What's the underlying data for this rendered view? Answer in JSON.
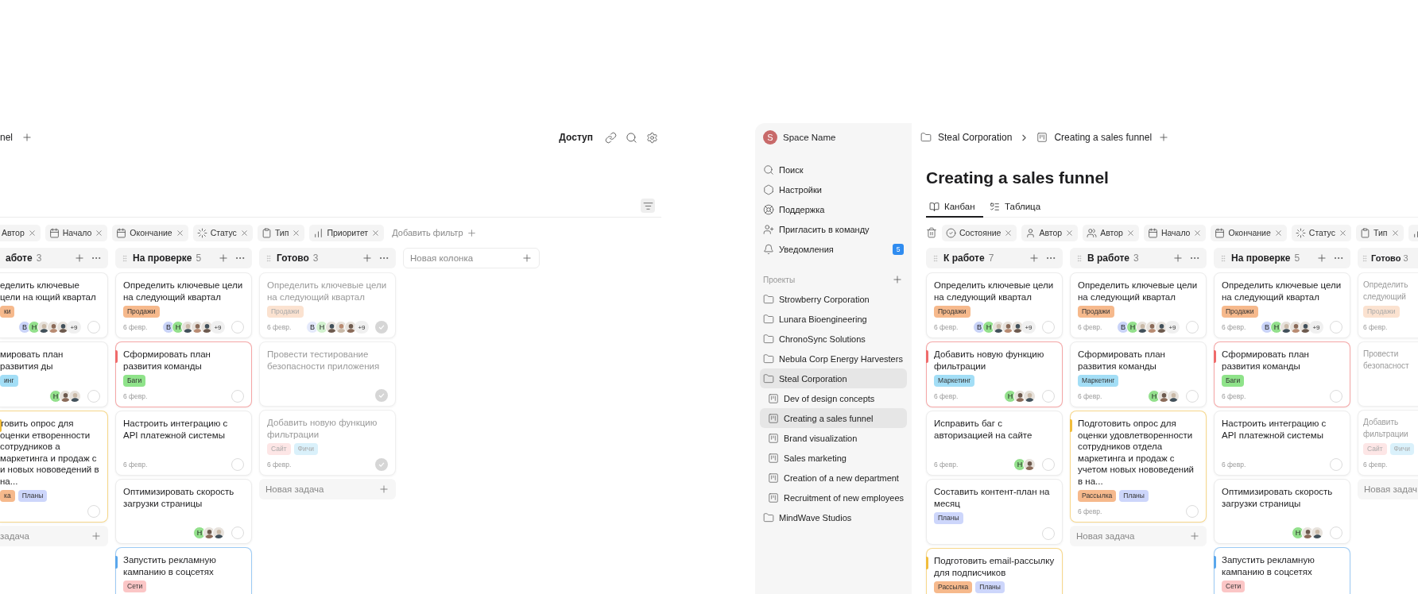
{
  "left_view": {
    "breadcrumb_tail": "nel",
    "access": "Доступ",
    "filters": [
      {
        "kind": "plain",
        "label": "Автор"
      },
      {
        "kind": "calendar",
        "label": "Начало"
      },
      {
        "kind": "calendar",
        "label": "Окончание"
      },
      {
        "kind": "status",
        "label": "Статус"
      },
      {
        "kind": "type",
        "label": "Тип"
      },
      {
        "kind": "priority",
        "label": "Приоритет"
      }
    ],
    "add_filter": "Добавить фильтр",
    "columns": [
      {
        "kind": "cut-left",
        "title": "аботе",
        "count": "3",
        "new_task": "задача",
        "cards": [
          {
            "title": "еделить ключевые цели на ющий квартал",
            "tags": [
              {
                "label": "ки",
                "color": "#f6b98c"
              }
            ],
            "avatars": [
              {
                "kind": "letter",
                "letter": "В",
                "color": "#c9d3f8"
              },
              {
                "kind": "letter",
                "letter": "Н",
                "color": "#93e08c"
              },
              {
                "kind": "photo"
              },
              {
                "kind": "photo"
              },
              {
                "kind": "photo"
              }
            ],
            "more": "+9",
            "done": false
          },
          {
            "title": "мировать план развития ды",
            "tags": [
              {
                "label": "инг",
                "color": "#a3def6"
              }
            ],
            "avatars": [
              {
                "kind": "letter",
                "letter": "Н",
                "color": "#93e08c"
              },
              {
                "kind": "photo"
              },
              {
                "kind": "photo"
              }
            ],
            "done": false
          },
          {
            "title": "товить опрос для оценки етворенности сотрудников а маркетинга и продаж с и новых нововедений в на...",
            "tags": [
              {
                "label": "ка",
                "color": "#f6b98c"
              },
              {
                "label": "Планы",
                "color": "#cdd6fb"
              }
            ],
            "color": "#f1bd3c",
            "done": false
          }
        ]
      },
      {
        "kind": "full",
        "title": "На проверке",
        "count": "5",
        "cards": [
          {
            "title": "Определить ключевые цели на следующий квартал",
            "tags": [
              {
                "label": "Продажи",
                "color": "#f6b98c"
              }
            ],
            "date": "6 февр.",
            "avatars": [
              {
                "kind": "letter",
                "letter": "В",
                "color": "#c9d3f8"
              },
              {
                "kind": "letter",
                "letter": "Н",
                "color": "#93e08c"
              },
              {
                "kind": "photo"
              },
              {
                "kind": "photo"
              },
              {
                "kind": "photo"
              }
            ],
            "more": "+9",
            "done": false
          },
          {
            "title": "Сформировать план развития команды",
            "tags": [
              {
                "label": "Баги",
                "color": "#8fe38a"
              }
            ],
            "date": "6 февр.",
            "color": "#ef6b6b",
            "done": false
          },
          {
            "title": "Настроить интеграцию с API платежной системы",
            "date": "6 февр.",
            "done": false
          },
          {
            "title": "Оптимизировать скорость загрузки страницы",
            "avatars": [
              {
                "kind": "letter",
                "letter": "Н",
                "color": "#93e08c"
              },
              {
                "kind": "photo"
              },
              {
                "kind": "photo"
              }
            ],
            "done": false
          },
          {
            "title": "Запустить рекламную кампанию в соцсетях",
            "tags": [
              {
                "label": "Сети",
                "color": "#fbc6c6"
              }
            ],
            "color": "#5aa7ec",
            "done": false
          }
        ]
      },
      {
        "kind": "full",
        "title": "Готово",
        "count": "3",
        "new_task": "Новая задача",
        "cards": [
          {
            "title": "Определить ключевые цели на следующий квартал",
            "tags": [
              {
                "label": "Продажи",
                "color": "#fbe2d0"
              }
            ],
            "date": "6 февр.",
            "avatars": [
              {
                "kind": "letter",
                "letter": "В",
                "color": "#e4e9fb"
              },
              {
                "kind": "letter",
                "letter": "Н",
                "color": "#d2f2cf"
              },
              {
                "kind": "photo"
              },
              {
                "kind": "photo"
              },
              {
                "kind": "photo"
              }
            ],
            "more": "+9",
            "done": true
          },
          {
            "title": "Провести тестирование безопасности приложения",
            "done": true
          },
          {
            "title": "Добавить новую функцию фильтрации",
            "tags": [
              {
                "label": "Сайт",
                "color": "#fde6e6"
              },
              {
                "label": "Фичи",
                "color": "#daf1fb"
              }
            ],
            "date": "6 февр.",
            "done": true
          }
        ]
      }
    ],
    "new_column": "Новая колонка"
  },
  "sidebar": {
    "space": {
      "initial": "S",
      "name": "Space Name"
    },
    "nav": [
      {
        "kind": "search",
        "label": "Поиск"
      },
      {
        "kind": "settings",
        "label": "Настройки"
      },
      {
        "kind": "support",
        "label": "Поддержка"
      },
      {
        "kind": "invite",
        "label": "Пригласить в команду"
      },
      {
        "kind": "bell",
        "label": "Уведомления",
        "badge": "5"
      }
    ],
    "projects_label": "Проекты",
    "projects": [
      {
        "name": "Strowberry Corporation",
        "selected": false
      },
      {
        "name": "Lunara Bioengineering",
        "selected": false
      },
      {
        "name": "ChronoSync Solutions",
        "selected": false
      },
      {
        "name": "Nebula Corp Energy Harvesters",
        "selected": false
      },
      {
        "name": "Steal Corporation",
        "selected": true,
        "children": [
          {
            "name": "Dev of design concepts",
            "selected": false
          },
          {
            "name": "Creating a sales funnel",
            "selected": true
          },
          {
            "name": "Brand visualization",
            "selected": false
          },
          {
            "name": "Sales marketing",
            "selected": false
          },
          {
            "name": "Creation of a new department",
            "selected": false
          },
          {
            "name": "Recruitment of new employees",
            "selected": false
          }
        ]
      },
      {
        "name": "MindWave Studios",
        "selected": false
      }
    ]
  },
  "main": {
    "breadcrumb": [
      "Steal Corporation",
      "Creating a sales funnel"
    ],
    "title": "Creating a sales funnel",
    "tabs": [
      {
        "kind": "kanban",
        "label": "Канбан",
        "selected": true
      },
      {
        "kind": "table",
        "label": "Таблица",
        "selected": false
      }
    ],
    "filters": [
      {
        "kind": "state",
        "label": "Состояние"
      },
      {
        "kind": "author",
        "label": "Автор"
      },
      {
        "kind": "authors",
        "label": "Автор"
      },
      {
        "kind": "calendar",
        "label": "Начало"
      },
      {
        "kind": "calendar",
        "label": "Окончание"
      },
      {
        "kind": "status",
        "label": "Статус"
      },
      {
        "kind": "type",
        "label": "Тип"
      },
      {
        "kind": "priority"
      }
    ],
    "columns": [
      {
        "kind": "full",
        "title": "К работе",
        "count": "7",
        "cards": [
          {
            "title": "Определить ключевые цели на следующий квартал",
            "tags": [
              {
                "label": "Продажи",
                "color": "#f6b98c"
              }
            ],
            "date": "6 февр.",
            "avatars": [
              {
                "kind": "letter",
                "letter": "В",
                "color": "#c9d3f8"
              },
              {
                "kind": "letter",
                "letter": "Н",
                "color": "#93e08c"
              },
              {
                "kind": "photo"
              },
              {
                "kind": "photo"
              },
              {
                "kind": "photo"
              }
            ],
            "more": "+9",
            "done": false
          },
          {
            "title": "Добавить новую функцию фильтрации",
            "tags": [
              {
                "label": "Маркетинг",
                "color": "#a3def6"
              }
            ],
            "date": "6 февр.",
            "color": "#ef6b6b",
            "avatars": [
              {
                "kind": "letter",
                "letter": "Н",
                "color": "#93e08c"
              },
              {
                "kind": "photo"
              },
              {
                "kind": "photo"
              }
            ],
            "done": false
          },
          {
            "title": "Исправить баг с авторизацией на сайте",
            "date": "6 февр.",
            "avatars": [
              {
                "kind": "letter",
                "letter": "Н",
                "color": "#93e08c"
              },
              {
                "kind": "photo"
              }
            ],
            "done": false
          },
          {
            "title": "Составить контент-план на месяц",
            "tags": [
              {
                "label": "Планы",
                "color": "#cdd6fb"
              }
            ],
            "done": false
          },
          {
            "title": "Подготовить email-рассылку для подписчиков",
            "tags": [
              {
                "label": "Рассылка",
                "color": "#f6b98c"
              },
              {
                "label": "Планы",
                "color": "#cdd6fb"
              }
            ],
            "color": "#f1bd3c",
            "done": false
          }
        ]
      },
      {
        "kind": "full",
        "title": "В работе",
        "count": "3",
        "new_task": "Новая задача",
        "cards": [
          {
            "title": "Определить ключевые цели на следующий квартал",
            "tags": [
              {
                "label": "Продажи",
                "color": "#f6b98c"
              }
            ],
            "date": "6 февр.",
            "avatars": [
              {
                "kind": "letter",
                "letter": "В",
                "color": "#c9d3f8"
              },
              {
                "kind": "letter",
                "letter": "Н",
                "color": "#93e08c"
              },
              {
                "kind": "photo"
              },
              {
                "kind": "photo"
              },
              {
                "kind": "photo"
              }
            ],
            "more": "+9",
            "done": false
          },
          {
            "title": "Сформировать план развития команды",
            "tags": [
              {
                "label": "Маркетинг",
                "color": "#a3def6"
              }
            ],
            "date": "6 февр.",
            "avatars": [
              {
                "kind": "letter",
                "letter": "Н",
                "color": "#93e08c"
              },
              {
                "kind": "photo"
              },
              {
                "kind": "photo"
              }
            ],
            "done": false
          },
          {
            "title": "Подготовить опрос для оценки удовлетворенности сотрудников отдела маркетинга и продаж с учетом новых нововедений в на...",
            "tags": [
              {
                "label": "Рассылка",
                "color": "#f6b98c"
              },
              {
                "label": "Планы",
                "color": "#cdd6fb"
              }
            ],
            "date": "6 февр.",
            "color": "#f1bd3c",
            "done": false
          }
        ]
      },
      {
        "kind": "full",
        "title": "На проверке",
        "count": "5",
        "cards": [
          {
            "title": "Определить ключевые цели на следующий квартал",
            "tags": [
              {
                "label": "Продажи",
                "color": "#f6b98c"
              }
            ],
            "date": "6 февр.",
            "avatars": [
              {
                "kind": "letter",
                "letter": "В",
                "color": "#c9d3f8"
              },
              {
                "kind": "letter",
                "letter": "Н",
                "color": "#93e08c"
              },
              {
                "kind": "photo"
              },
              {
                "kind": "photo"
              },
              {
                "kind": "photo"
              }
            ],
            "more": "+9",
            "done": false
          },
          {
            "title": "Сформировать план развития команды",
            "tags": [
              {
                "label": "Баги",
                "color": "#8fe38a"
              }
            ],
            "date": "6 февр.",
            "color": "#ef6b6b",
            "done": false
          },
          {
            "title": "Настроить интеграцию с API платежной системы",
            "date": "6 февр.",
            "done": false
          },
          {
            "title": "Оптимизировать скорость загрузки страницы",
            "avatars": [
              {
                "kind": "letter",
                "letter": "Н",
                "color": "#93e08c"
              },
              {
                "kind": "photo"
              },
              {
                "kind": "photo"
              }
            ],
            "done": false
          },
          {
            "title": "Запустить рекламную кампанию в соцсетях",
            "tags": [
              {
                "label": "Сети",
                "color": "#fbc6c6"
              }
            ],
            "color": "#5aa7ec",
            "done": false
          }
        ]
      },
      {
        "kind": "cut-right",
        "title": "Готово",
        "count": "3",
        "new_task": "Новая задач",
        "cards": [
          {
            "title": "Определить следующий",
            "tags": [
              {
                "label": "Продажи",
                "color": "#fbe2d0"
              }
            ],
            "date": "6 февр.",
            "done": true
          },
          {
            "title": "Провести безопасност",
            "done": true
          },
          {
            "title": "Добавить фильтрации",
            "tags": [
              {
                "label": "Сайт",
                "color": "#fde6e6"
              },
              {
                "label": "Фичи",
                "color": "#daf1fb"
              }
            ],
            "date": "6 февр.",
            "done": true
          }
        ]
      }
    ]
  }
}
